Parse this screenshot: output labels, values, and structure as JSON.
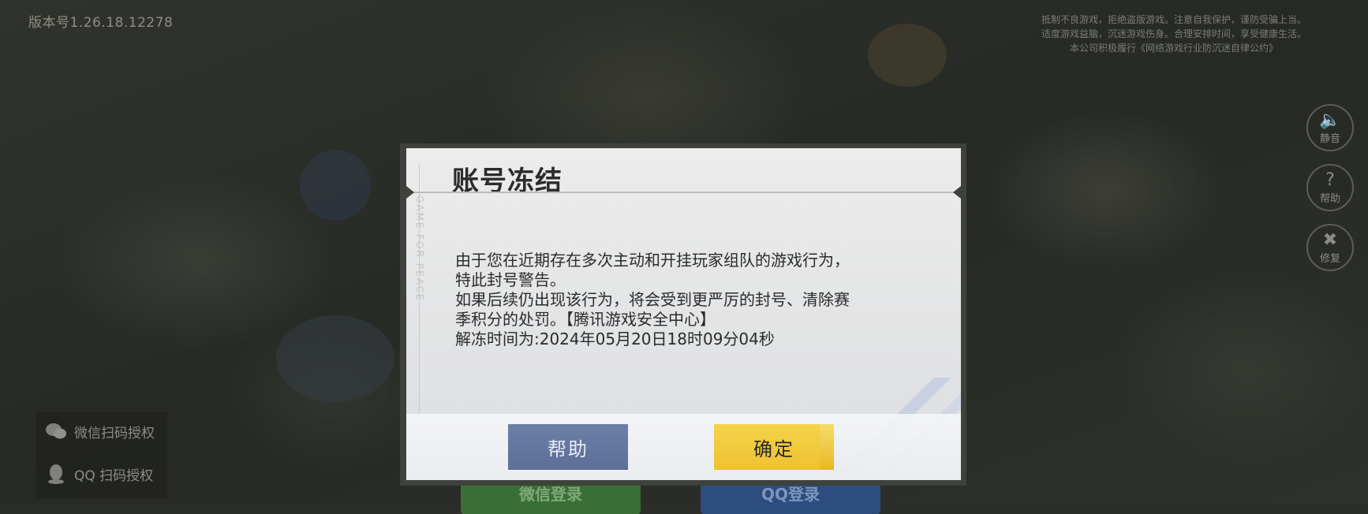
{
  "version_label": "版本号1.26.18.12278",
  "health_notice": {
    "line1": "抵制不良游戏，拒绝盗版游戏。注意自我保护，谨防受骗上当。",
    "line2": "适度游戏益脑，沉迷游戏伤身。合理安排时间，享受健康生活。",
    "line3": "本公司积极履行《网络游戏行业防沉迷自律公约》"
  },
  "side_buttons": [
    {
      "label": "静音",
      "icon": "speaker-icon"
    },
    {
      "label": "帮助",
      "icon": "question-icon"
    },
    {
      "label": "修复",
      "icon": "wrench-icon"
    }
  ],
  "login_options": [
    {
      "label": "微信扫码授权",
      "icon": "wechat-icon"
    },
    {
      "label": "QQ 扫码授权",
      "icon": "qq-icon"
    }
  ],
  "bottom_buttons": [
    {
      "label": "微信登录",
      "color": "#3f9a3c"
    },
    {
      "label": "QQ登录",
      "color": "#3b6fb8"
    }
  ],
  "dialog": {
    "title": "账号冻结",
    "side_text": "GAME FOR PEACE",
    "message_lines": [
      "由于您在近期存在多次主动和开挂玩家组队的游戏行为，",
      "特此封号警告。",
      "如果后续仍出现该行为，将会受到更严厉的封号、清除赛",
      "季积分的处罚。【腾讯游戏安全中心】",
      "解冻时间为:2024年05月20日18时09分04秒"
    ],
    "help_button": "帮助",
    "ok_button": "确定",
    "colors": {
      "help_button": "#6577a0",
      "ok_button": "#f2c93c"
    }
  }
}
